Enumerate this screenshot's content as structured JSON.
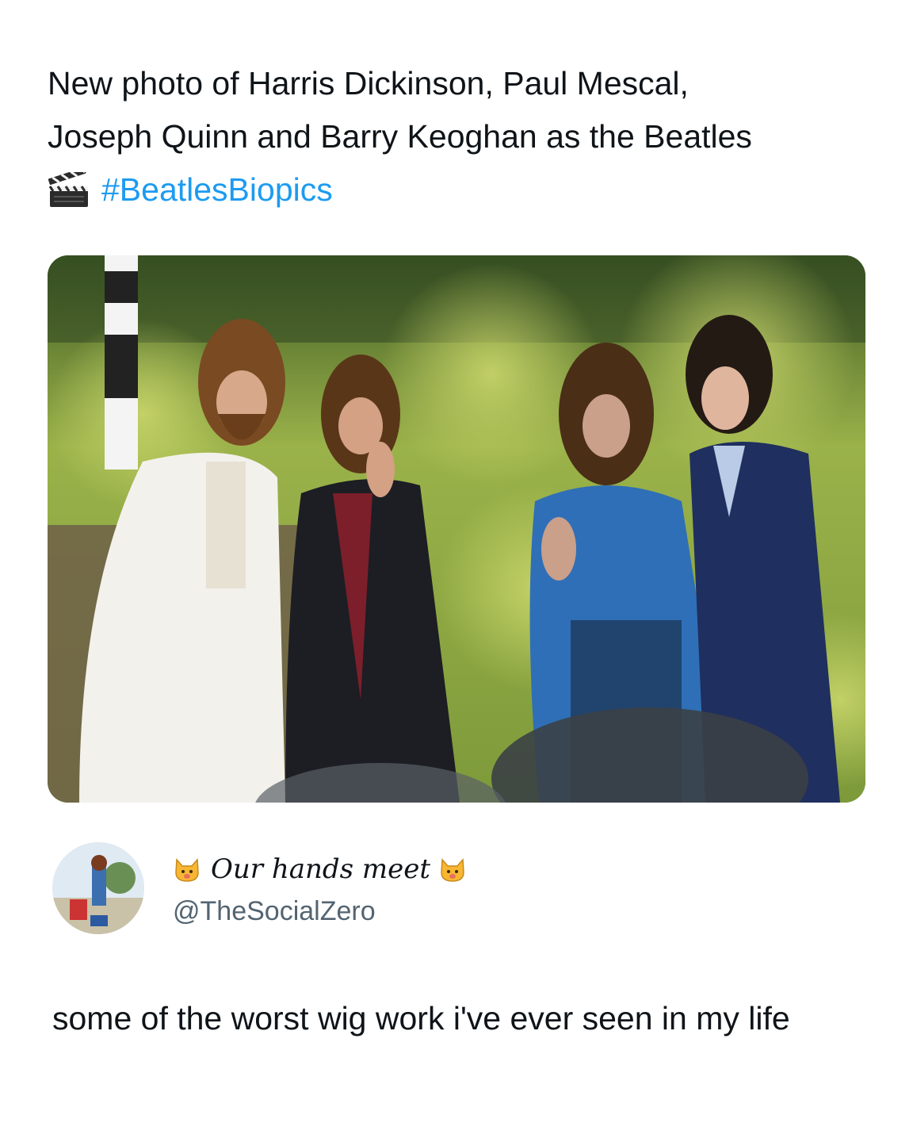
{
  "quoted_post": {
    "text_line1": "New photo of Harris Dickinson, Paul Mescal,",
    "text_line2": "Joseph Quinn and Barry Keoghan as the Beatles",
    "emoji_icon": "clapper-board-icon",
    "hashtag": "#BeatlesBiopics",
    "hashtag_color": "#1d9bf0"
  },
  "reply": {
    "display_name": "Our hands meet",
    "name_emoji_icon": "cat-face-icon",
    "handle": "@TheSocialZero",
    "text": "some of the worst wig work i've ever seen in my life"
  },
  "colors": {
    "text": "#0f1419",
    "secondary": "#536471",
    "link": "#1d9bf0"
  }
}
